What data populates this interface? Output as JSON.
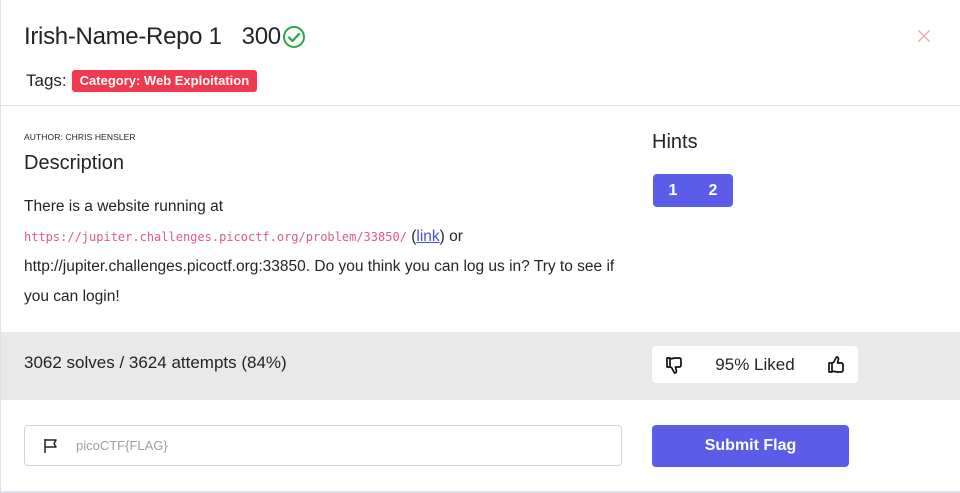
{
  "header": {
    "title": "Irish-Name-Repo 1",
    "points": "300",
    "solved_icon": "check-circle-icon",
    "close_icon": "close-icon",
    "tags_label": "Tags:",
    "tags": [
      "Category: Web Exploitation"
    ]
  },
  "description": {
    "author": "AUTHOR: CHRIS HENSLER",
    "heading": "Description",
    "line1": "There is a website running at",
    "code_url": "https://jupiter.challenges.picoctf.org/problem/33850/",
    "link_open": " (",
    "link_text": "link",
    "link_close": ") or",
    "rest": "http://jupiter.challenges.picoctf.org:33850. Do you think you can log us in? Try to see if you can login!"
  },
  "hints": {
    "heading": "Hints",
    "buttons": [
      "1",
      "2"
    ]
  },
  "stats": {
    "solves_text": "3062 solves / 3624 attempts (84%)",
    "liked_text": "95% Liked",
    "dislike_icon": "thumbs-down-icon",
    "like_icon": "thumbs-up-icon"
  },
  "flag_form": {
    "placeholder": "picoCTF{FLAG}",
    "flag_icon": "flag-icon",
    "submit_label": "Submit Flag"
  },
  "colors": {
    "accent": "#5b5de8",
    "tag_bg": "#f0384f",
    "solved_green": "#28a745",
    "code_pink": "#e0578e"
  }
}
